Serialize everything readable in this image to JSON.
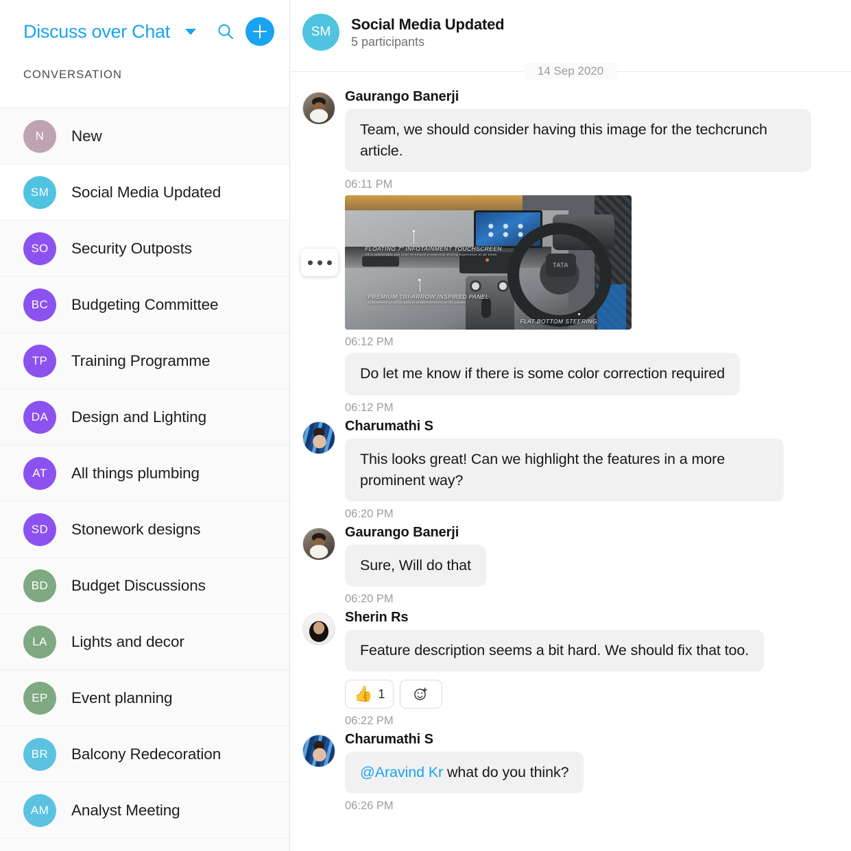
{
  "sidebar": {
    "title": "Discuss over Chat",
    "caret_icon": "chevron-down-icon",
    "search_icon": "search-icon",
    "add_icon": "plus-icon",
    "section_label": "CONVERSATION",
    "items": [
      {
        "initials": "N",
        "label": "New",
        "color": "#bfa3b0",
        "selected": false
      },
      {
        "initials": "SM",
        "label": "Social Media Updated",
        "color": "#4fc3e0",
        "selected": true
      },
      {
        "initials": "SO",
        "label": "Security Outposts",
        "color": "#8c52f0",
        "selected": false
      },
      {
        "initials": "BC",
        "label": "Budgeting Committee",
        "color": "#8c52f0",
        "selected": false
      },
      {
        "initials": "TP",
        "label": "Training Programme",
        "color": "#8c52f0",
        "selected": false
      },
      {
        "initials": "DA",
        "label": "Design and Lighting",
        "color": "#8c52f0",
        "selected": false
      },
      {
        "initials": "AT",
        "label": "All things plumbing",
        "color": "#8c52f0",
        "selected": false
      },
      {
        "initials": "SD",
        "label": "Stonework designs",
        "color": "#8c52f0",
        "selected": false
      },
      {
        "initials": "BD",
        "label": "Budget Discussions",
        "color": "#7fa981",
        "selected": false
      },
      {
        "initials": "LA",
        "label": "Lights and decor",
        "color": "#7fa981",
        "selected": false
      },
      {
        "initials": "EP",
        "label": "Event planning",
        "color": "#7fa981",
        "selected": false
      },
      {
        "initials": "BR",
        "label": "Balcony Redecoration",
        "color": "#5bc2e0",
        "selected": false
      },
      {
        "initials": "AM",
        "label": "Analyst Meeting",
        "color": "#5bc2e0",
        "selected": false
      }
    ]
  },
  "chat": {
    "avatar_initials": "SM",
    "avatar_color": "#4fc3e0",
    "title": "Social Media Updated",
    "participants": "5 participants",
    "date_divider": "14 Sep 2020",
    "messages": [
      {
        "author": "Gaurango Banerji",
        "avatar": "av-gaurango",
        "text": "Team, we should consider having this image for the techcrunch article.",
        "time": "06:11 PM",
        "type": "text"
      },
      {
        "author": "",
        "avatar": "",
        "text": "",
        "time": "06:12 PM",
        "type": "image",
        "image_alt": "car-interior-photo",
        "image_captions": {
          "caption1": "FLOATING 7\" INFOTAINMENT TOUCHSCREEN",
          "caption1_sub": "All a comfortable eye level to ensure a seamless driving experience at all times",
          "caption2": "PREMIUM TRI-ARROW INSPIRED PANEL",
          "caption2_sub": "Customised tri-arrow pattern embellishments on the panels",
          "caption3": "FLAT BOTTOM STEERING",
          "brand": "TATA"
        },
        "hover_menu_icon": "more-options-icon"
      },
      {
        "author": "",
        "avatar": "",
        "text": "Do let me know if there is some color correction required",
        "time": "06:12 PM",
        "type": "text"
      },
      {
        "author": "Charumathi S",
        "avatar": "av-charumathi",
        "text": "This looks great! Can we highlight the features in a more prominent way?",
        "time": "06:20 PM",
        "type": "text"
      },
      {
        "author": "Gaurango Banerji",
        "avatar": "av-gaurango",
        "text": "Sure, Will do that",
        "time": "06:20 PM",
        "type": "text"
      },
      {
        "author": "Sherin Rs",
        "avatar": "av-sherin",
        "text": "Feature description seems a bit hard. We should fix that too.",
        "time": "06:22 PM",
        "type": "text",
        "reactions": {
          "emoji": "👍",
          "count": "1",
          "add_icon": "add-reaction-icon"
        }
      },
      {
        "author": "Charumathi S",
        "avatar": "av-charumathi",
        "mention": "@Aravind Kr",
        "text": " what do you think?",
        "time": "06:26 PM",
        "type": "mention"
      }
    ]
  }
}
